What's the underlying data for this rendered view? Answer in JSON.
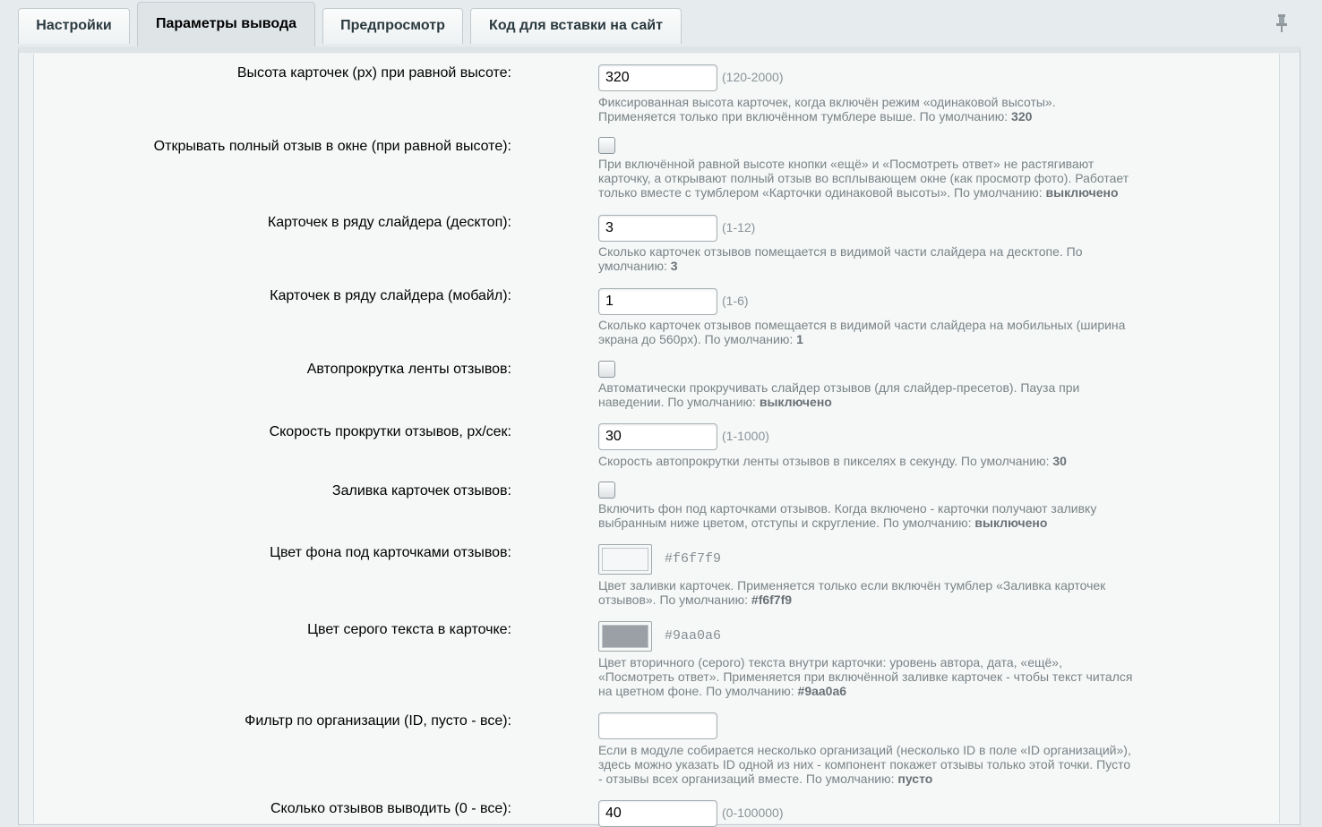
{
  "tabs": [
    {
      "label": "Настройки"
    },
    {
      "label": "Параметры вывода"
    },
    {
      "label": "Предпросмотр"
    },
    {
      "label": "Код для вставки на сайт"
    }
  ],
  "active_tab": "Параметры вывода",
  "pin_icon": "pin-icon",
  "fields": {
    "card_height": {
      "label": "Высота карточек (px) при равной высоте:",
      "value": "320",
      "range": "(120-2000)",
      "hint_text": "Фиксированная высота карточек, когда включён режим «одинаковой высоты». Применяется только при включённом тумблере выше. По умолчанию: ",
      "hint_default": "320"
    },
    "open_full_review": {
      "label": "Открывать полный отзыв в окне (при равной высоте):",
      "checked": false,
      "hint_text": "При включённой равной высоте кнопки «ещё» и «Посмотреть ответ» не растягивают карточку, а открывают полный отзыв во всплывающем окне (как просмотр фото). Работает только вместе с тумблером «Карточки одинаковой высоты». По умолчанию: ",
      "hint_default": "выключено"
    },
    "slider_desktop": {
      "label": "Карточек в ряду слайдера (десктоп):",
      "value": "3",
      "range": "(1-12)",
      "hint_text": "Сколько карточек отзывов помещается в видимой части слайдера на десктопе. По умолчанию: ",
      "hint_default": "3"
    },
    "slider_mobile": {
      "label": "Карточек в ряду слайдера (мобайл):",
      "value": "1",
      "range": "(1-6)",
      "hint_text": "Сколько карточек отзывов помещается в видимой части слайдера на мобильных (ширина экрана до 560px). По умолчанию: ",
      "hint_default": "1"
    },
    "autoscroll": {
      "label": "Автопрокрутка ленты отзывов:",
      "checked": false,
      "hint_text": "Автоматически прокручивать слайдер отзывов (для слайдер-пресетов). Пауза при наведении. По умолчанию: ",
      "hint_default": "выключено"
    },
    "scroll_speed": {
      "label": "Скорость прокрутки отзывов, px/сек:",
      "value": "30",
      "range": "(1-1000)",
      "hint_text": "Скорость автопрокрутки ленты отзывов в пикселях в секунду. По умолчанию: ",
      "hint_default": "30"
    },
    "card_fill": {
      "label": "Заливка карточек отзывов:",
      "checked": false,
      "hint_text": "Включить фон под карточками отзывов. Когда включено - карточки получают заливку выбранным ниже цветом, отступы и скругление. По умолчанию: ",
      "hint_default": "выключено"
    },
    "card_bg_color": {
      "label": "Цвет фона под карточками отзывов:",
      "color": "#f6f7f9",
      "hex": "#f6f7f9",
      "hint_text": "Цвет заливки карточек. Применяется только если включён тумблер «Заливка карточек отзывов». По умолчанию: ",
      "hint_default": "#f6f7f9"
    },
    "gray_text_color": {
      "label": "Цвет серого текста в карточке:",
      "color": "#9aa0a6",
      "hex": "#9aa0a6",
      "hint_text": "Цвет вторичного (серого) текста внутри карточки: уровень автора, дата, «ещё», «Посмотреть ответ». Применяется при включённой заливке карточек - чтобы текст читался на цветном фоне. По умолчанию: ",
      "hint_default": "#9aa0a6"
    },
    "org_filter": {
      "label": "Фильтр по организации (ID, пусто - все):",
      "value": "",
      "hint_text": "Если в модуле собирается несколько организаций (несколько ID в поле «ID организаций»), здесь можно указать ID одной из них - компонент покажет отзывы только этой точки. Пусто - отзывы всех организаций вместе. По умолчанию: ",
      "hint_default": "пусто"
    },
    "reviews_count": {
      "label": "Сколько отзывов выводить (0 - все):",
      "value": "40",
      "range": "(0-100000)"
    }
  }
}
